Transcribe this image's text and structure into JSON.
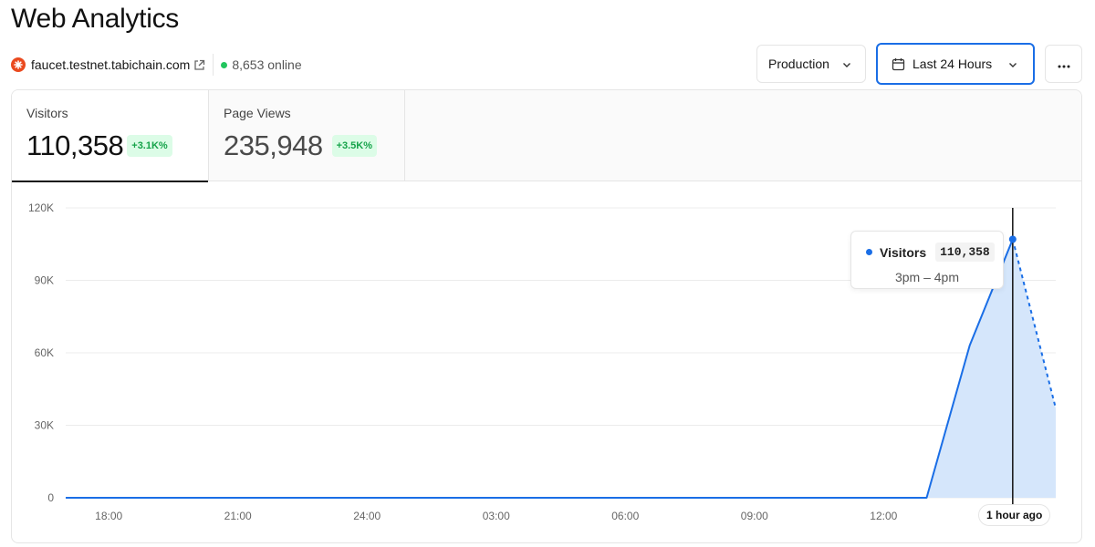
{
  "header": {
    "title": "Web Analytics"
  },
  "site": {
    "domain": "faucet.testnet.tabichain.com",
    "online": "8,653 online"
  },
  "controls": {
    "environment": "Production",
    "range": "Last 24 Hours"
  },
  "tabs": [
    {
      "label": "Visitors",
      "value": "110,358",
      "change": "+3.1K%"
    },
    {
      "label": "Page Views",
      "value": "235,948",
      "change": "+3.5K%"
    }
  ],
  "tooltip": {
    "series": "Visitors",
    "value": "110,358",
    "range": "3pm – 4pm"
  },
  "hover_label": "1 hour ago",
  "colors": {
    "accent": "#1a6ee6",
    "area": "#d5e6fb",
    "positive": "#16a34a"
  },
  "chart_data": {
    "type": "area",
    "title": "",
    "ylabel": "",
    "xlabel": "",
    "ylim": [
      0,
      120000
    ],
    "yticks": [
      0,
      30000,
      60000,
      90000,
      120000
    ],
    "ytick_labels": [
      "0",
      "30K",
      "60K",
      "90K",
      "120K"
    ],
    "xtick_labels": [
      "18:00",
      "21:00",
      "24:00",
      "03:00",
      "06:00",
      "09:00",
      "12:00"
    ],
    "x_hours": [
      "17:00",
      "18:00",
      "19:00",
      "20:00",
      "21:00",
      "22:00",
      "23:00",
      "00:00",
      "01:00",
      "02:00",
      "03:00",
      "04:00",
      "05:00",
      "06:00",
      "07:00",
      "08:00",
      "09:00",
      "10:00",
      "11:00",
      "12:00",
      "13:00",
      "14:00",
      "15:00",
      "16:00"
    ],
    "series": [
      {
        "name": "Visitors",
        "values": [
          0,
          0,
          0,
          0,
          0,
          0,
          0,
          0,
          0,
          0,
          0,
          0,
          0,
          0,
          0,
          0,
          0,
          0,
          0,
          0,
          0,
          63000,
          107000,
          37000
        ],
        "dashed_last_segment": true
      }
    ],
    "highlight_index": 22,
    "grid": true
  }
}
